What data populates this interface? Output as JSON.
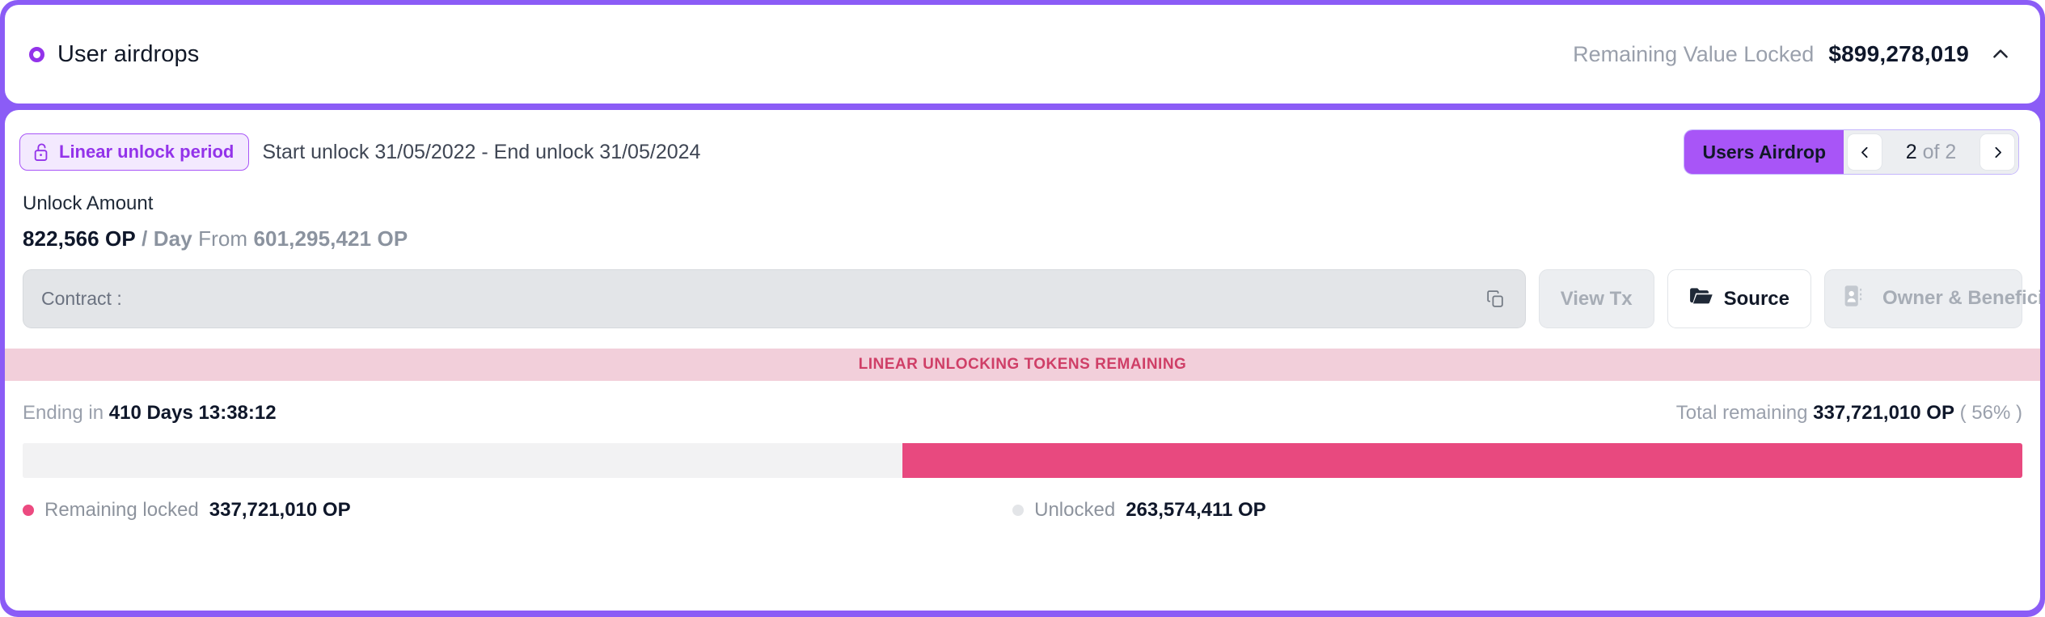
{
  "header": {
    "icon": "ring-dot-icon",
    "title": "User airdrops",
    "remaining_label": "Remaining Value Locked",
    "remaining_value": "$899,278,019",
    "collapse_icon": "chevron-up-icon"
  },
  "details": {
    "badge": {
      "icon": "unlock-padlock-icon",
      "label": "Linear unlock period"
    },
    "period": "Start unlock 31/05/2022 - End unlock 31/05/2024",
    "pager": {
      "tag": "Users Airdrop",
      "prev_icon": "chevron-left-icon",
      "next_icon": "chevron-right-icon",
      "current": "2",
      "of": "of 2"
    },
    "unlock_amount_label": "Unlock Amount",
    "rate_value": "822,566 OP",
    "rate_unit": "/ Day",
    "from_label": "From",
    "from_value": "601,295,421 OP",
    "contract_label": "Contract :",
    "contract_value": "",
    "copy_icon": "copy-icon",
    "buttons": [
      {
        "label": "View Tx",
        "icon": "",
        "state": "disabled"
      },
      {
        "label": "Source",
        "icon": "folder-open-icon",
        "state": "enabled"
      },
      {
        "label": "Owner & Beneficiary",
        "icon": "contact-card-icon",
        "state": "disabled"
      }
    ]
  },
  "banner": {
    "text": "LINEAR UNLOCKING TOKENS REMAINING"
  },
  "progress": {
    "ending_label": "Ending in",
    "ending_value": "410 Days 13:38:12",
    "total_label": "Total remaining",
    "total_value": "337,721,010 OP",
    "total_pct": "( 56% )",
    "locked_percent": 56,
    "unlocked_percent": 44,
    "legend": [
      {
        "label": "Remaining locked",
        "value": "337,721,010 OP",
        "color": "#ec4a80"
      },
      {
        "label": "Unlocked",
        "value": "263,574,411 OP",
        "color": "#e3e5e8"
      }
    ]
  },
  "colors": {
    "accent_purple": "#8b5cf6",
    "badge_purple": "#9333ea",
    "pink": "#e8497f",
    "banner_bg": "#f2cfda",
    "banner_text": "#cf3f67"
  }
}
